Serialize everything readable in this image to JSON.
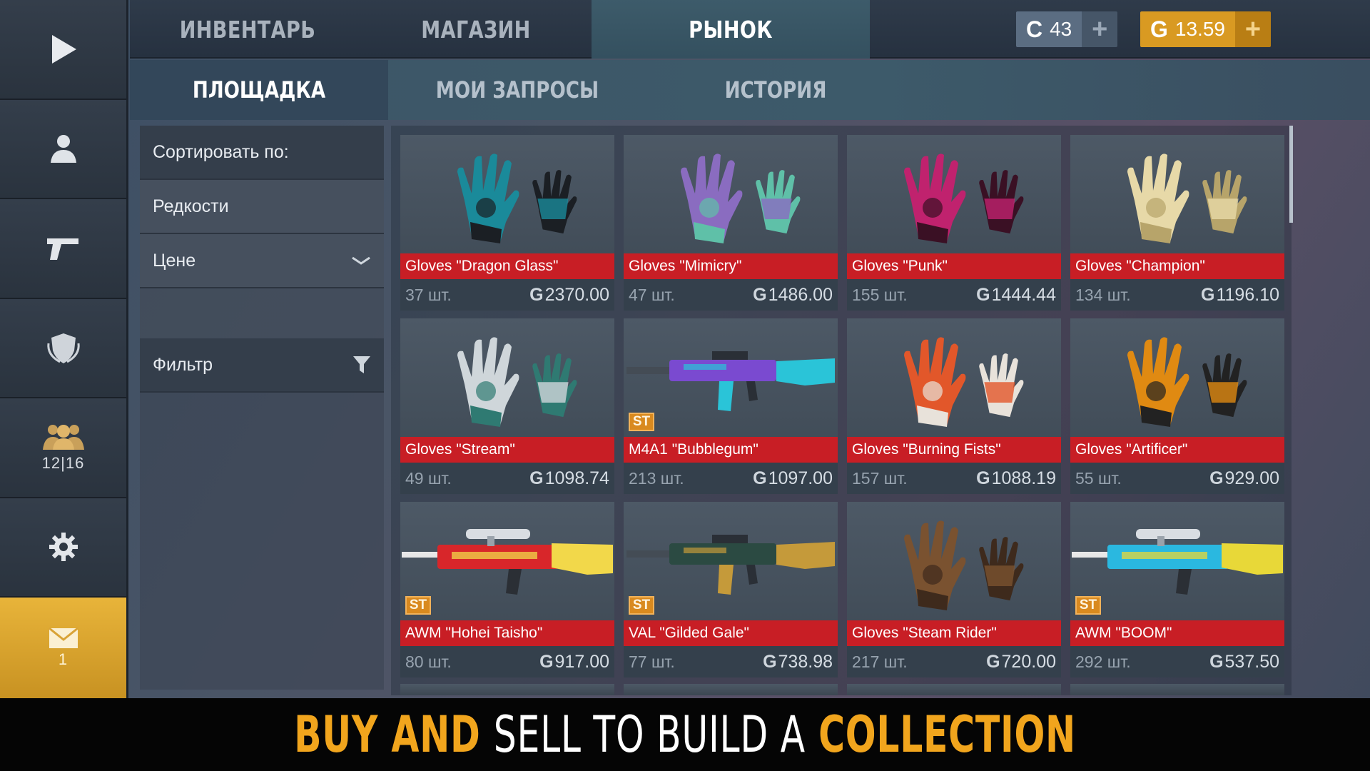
{
  "colors": {
    "accent_gold": "#d99a22",
    "name_red": "#c81e25",
    "banner_yellow": "#f1a51d"
  },
  "sidebar": {
    "items": [
      {
        "icon": "play-icon"
      },
      {
        "icon": "profile-icon"
      },
      {
        "icon": "pistol-icon"
      },
      {
        "icon": "clan-shield-icon"
      },
      {
        "icon": "friends-icon",
        "count": "12|16"
      },
      {
        "icon": "gear-icon"
      },
      {
        "icon": "mail-icon",
        "count": "1"
      }
    ]
  },
  "top_tabs": [
    {
      "label": "ИНВЕНТАРЬ",
      "active": false
    },
    {
      "label": "МАГАЗИН",
      "active": false
    },
    {
      "label": "РЫНОК",
      "active": true
    }
  ],
  "currency": {
    "silver": {
      "icon": "C",
      "value": "43"
    },
    "gold": {
      "icon": "G",
      "value": "13.59"
    },
    "plus": "+"
  },
  "sub_tabs": [
    {
      "label": "ПЛОЩАДКА",
      "active": true
    },
    {
      "label": "МОИ ЗАПРОСЫ",
      "active": false
    },
    {
      "label": "ИСТОРИЯ",
      "active": false
    }
  ],
  "filter_panel": {
    "sort_label": "Сортировать по:",
    "options": [
      "Редкости",
      "Цене"
    ],
    "filter_label": "Фильтр"
  },
  "currency_symbol": "G",
  "items": [
    {
      "name": "Gloves \"Dragon Glass\"",
      "qty": "37 шт.",
      "price": "2370.00",
      "st": false,
      "kind": "gloves",
      "c1": "#1a8a9a",
      "c2": "#1b1f24"
    },
    {
      "name": "Gloves \"Mimicry\"",
      "qty": "47 шт.",
      "price": "1486.00",
      "st": false,
      "kind": "gloves",
      "c1": "#8a6cc0",
      "c2": "#5fc0a8"
    },
    {
      "name": "Gloves \"Punk\"",
      "qty": "155 шт.",
      "price": "1444.44",
      "st": false,
      "kind": "gloves",
      "c1": "#c0226e",
      "c2": "#3a1024"
    },
    {
      "name": "Gloves \"Champion\"",
      "qty": "134 шт.",
      "price": "1196.10",
      "st": false,
      "kind": "gloves",
      "c1": "#e7d9a8",
      "c2": "#b7a46a"
    },
    {
      "name": "Gloves \"Stream\"",
      "qty": "49 шт.",
      "price": "1098.74",
      "st": false,
      "kind": "gloves",
      "c1": "#cfd6da",
      "c2": "#2f7a72"
    },
    {
      "name": "M4A1 \"Bubblegum\"",
      "qty": "213 шт.",
      "price": "1097.00",
      "st": true,
      "st_label": "ST",
      "kind": "rifle",
      "c1": "#7a4ad0",
      "c2": "#2ac4d8"
    },
    {
      "name": "Gloves \"Burning Fists\"",
      "qty": "157 шт.",
      "price": "1088.19",
      "st": false,
      "kind": "gloves",
      "c1": "#e2572a",
      "c2": "#e8e2da"
    },
    {
      "name": "Gloves \"Artificer\"",
      "qty": "55 шт.",
      "price": "929.00",
      "st": false,
      "kind": "gloves",
      "c1": "#e08a12",
      "c2": "#222222"
    },
    {
      "name": "AWM \"Hohei Taisho\"",
      "qty": "80 шт.",
      "price": "917.00",
      "st": true,
      "st_label": "ST",
      "kind": "sniper",
      "c1": "#d8262a",
      "c2": "#f2d84a"
    },
    {
      "name": "VAL \"Gilded Gale\"",
      "qty": "77 шт.",
      "price": "738.98",
      "st": true,
      "st_label": "ST",
      "kind": "rifle",
      "c1": "#2b4a42",
      "c2": "#c59a3a"
    },
    {
      "name": "Gloves \"Steam Rider\"",
      "qty": "217 шт.",
      "price": "720.00",
      "st": false,
      "kind": "gloves",
      "c1": "#7a5230",
      "c2": "#3e2a1c"
    },
    {
      "name": "AWM \"BOOM\"",
      "qty": "292 шт.",
      "price": "537.50",
      "st": true,
      "st_label": "ST",
      "kind": "sniper",
      "c1": "#2ab8e0",
      "c2": "#e8d838"
    }
  ],
  "banner": {
    "part1": "BUY AND",
    "part2": "SELL TO BUILD A",
    "part3": "COLLECTION"
  }
}
